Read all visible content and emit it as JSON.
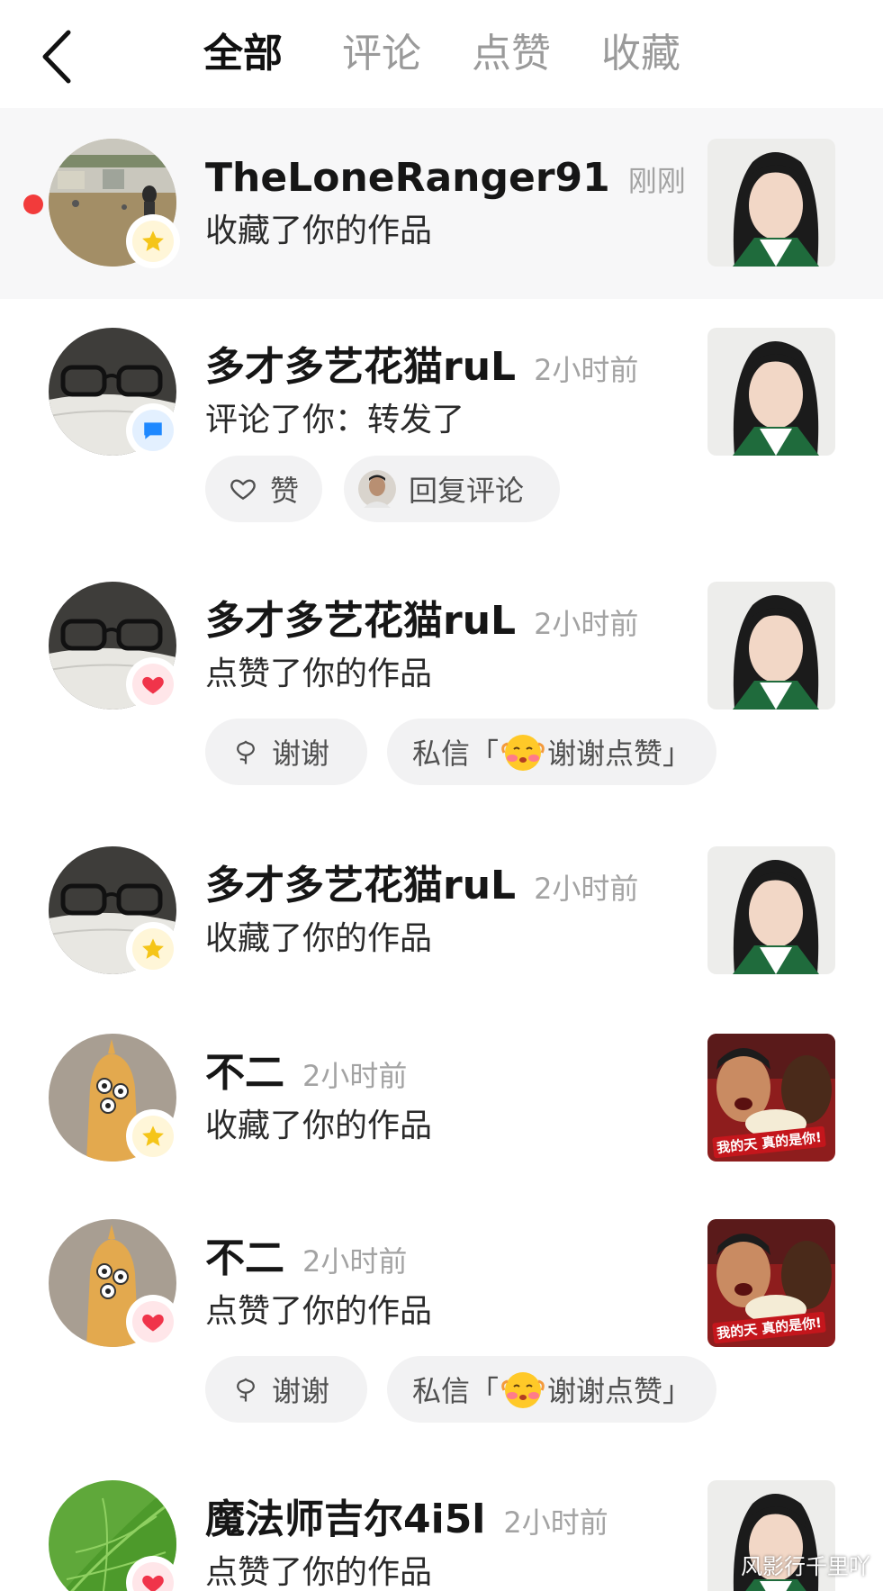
{
  "tabs": [
    {
      "label": "全部",
      "active": true
    },
    {
      "label": "评论",
      "active": false
    },
    {
      "label": "点赞",
      "active": false
    },
    {
      "label": "收藏",
      "active": false
    }
  ],
  "items": [
    {
      "name": "TheLoneRanger91",
      "time": "刚刚",
      "action": "收藏了你的作品",
      "badge": "star-icon",
      "unread": true,
      "avatar": "gym-photo",
      "thumb": "woman-photo"
    },
    {
      "name": "多才多艺花猫ruL",
      "time": "2小时前",
      "action": "评论了你：转发了",
      "badge": "comment-icon",
      "unread": false,
      "avatar": "glasses-photo",
      "thumb": "woman-photo",
      "buttons": [
        {
          "icon": "heart-outline-icon",
          "label": "赞"
        },
        {
          "icon": "small-avatar",
          "label": "回复评论"
        }
      ]
    },
    {
      "name": "多才多艺花猫ruL",
      "time": "2小时前",
      "action": "点赞了你的作品",
      "badge": "heart-icon",
      "unread": false,
      "avatar": "glasses-photo",
      "thumb": "woman-photo",
      "buttons": [
        {
          "icon": "flower-icon",
          "label": "谢谢"
        },
        {
          "icon": "emoji-icon",
          "label": "私信「",
          "label2": "谢谢点赞」"
        }
      ]
    },
    {
      "name": "多才多艺花猫ruL",
      "time": "2小时前",
      "action": "收藏了你的作品",
      "badge": "star-icon",
      "unread": false,
      "avatar": "glasses-photo",
      "thumb": "woman-photo"
    },
    {
      "name": "不二",
      "time": "2小时前",
      "action": "收藏了你的作品",
      "badge": "star-icon",
      "unread": false,
      "avatar": "cartoon-avatar",
      "thumb": "meme-photo",
      "thumb_caption": "我的天 真的是你!"
    },
    {
      "name": "不二",
      "time": "2小时前",
      "action": "点赞了你的作品",
      "badge": "heart-icon",
      "unread": false,
      "avatar": "cartoon-avatar",
      "thumb": "meme-photo",
      "thumb_caption": "我的天 真的是你!",
      "buttons": [
        {
          "icon": "flower-icon",
          "label": "谢谢"
        },
        {
          "icon": "emoji-icon",
          "label": "私信「",
          "label2": "谢谢点赞」"
        }
      ]
    },
    {
      "name": "魔法师吉尔4i5l",
      "time": "2小时前",
      "action": "点赞了你的作品",
      "badge": "heart-icon",
      "unread": false,
      "avatar": "leaf-photo",
      "thumb": "woman-photo"
    }
  ],
  "watermark": "风影行千里吖",
  "colors": {
    "unread_dot": "#f23b3b",
    "star": "#f5c518",
    "heart": "#f0344a",
    "comment": "#1e88ff",
    "unread_bg": "#f7f7f8"
  }
}
